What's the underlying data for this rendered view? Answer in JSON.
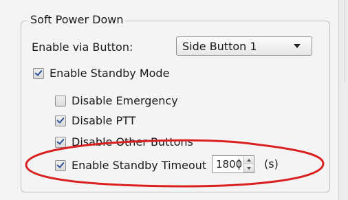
{
  "group": {
    "title": "Soft Power Down"
  },
  "enable_via": {
    "label": "Enable via Button:",
    "selected": "Side Button 1"
  },
  "standby": {
    "label": "Enable Standby Mode",
    "checked": true
  },
  "options": [
    {
      "label": "Disable Emergency",
      "checked": false
    },
    {
      "label": "Disable PTT",
      "checked": true
    },
    {
      "label": "Disable Other Buttons",
      "checked": true
    },
    {
      "label": "Enable Standby Timeout",
      "checked": true
    }
  ],
  "timeout": {
    "value": "1800",
    "unit": "(s)"
  },
  "colors": {
    "annotation": "#d9201f",
    "check": "#2a4f9a"
  }
}
